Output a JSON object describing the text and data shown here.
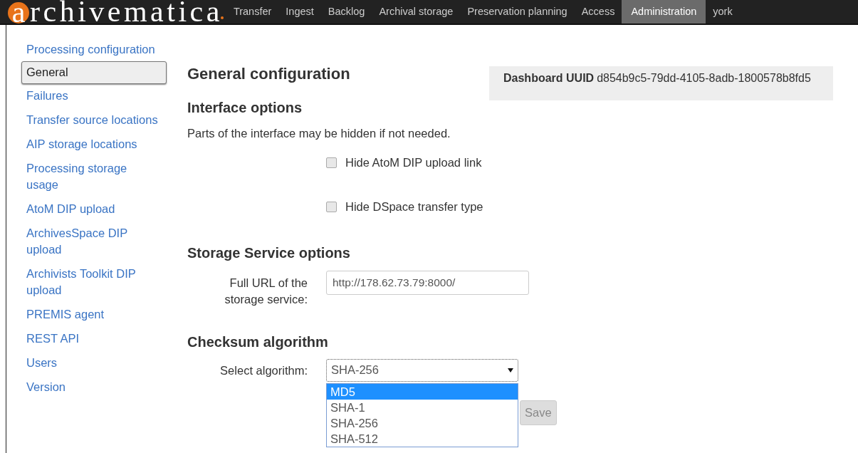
{
  "logo": {
    "mark": "a",
    "text": "rchivematica"
  },
  "nav": [
    {
      "label": "Transfer",
      "selected": false
    },
    {
      "label": "Ingest",
      "selected": false
    },
    {
      "label": "Backlog",
      "selected": false
    },
    {
      "label": "Archival storage",
      "selected": false
    },
    {
      "label": "Preservation planning",
      "selected": false
    },
    {
      "label": "Access",
      "selected": false
    },
    {
      "label": "Administration",
      "selected": true
    },
    {
      "label": "york",
      "selected": false
    }
  ],
  "sidebar": [
    {
      "label": "Processing configuration",
      "selected": false
    },
    {
      "label": "General",
      "selected": true
    },
    {
      "label": "Failures",
      "selected": false
    },
    {
      "label": "Transfer source locations",
      "selected": false
    },
    {
      "label": "AIP storage locations",
      "selected": false
    },
    {
      "label": "Processing storage usage",
      "selected": false
    },
    {
      "label": "AtoM DIP upload",
      "selected": false
    },
    {
      "label": "ArchivesSpace DIP upload",
      "selected": false
    },
    {
      "label": "Archivists Toolkit DIP upload",
      "selected": false
    },
    {
      "label": "PREMIS agent",
      "selected": false
    },
    {
      "label": "REST API",
      "selected": false
    },
    {
      "label": "Users",
      "selected": false
    },
    {
      "label": "Version",
      "selected": false
    }
  ],
  "title": "General configuration",
  "dashboard": {
    "label": "Dashboard UUID",
    "value": "d854b9c5-79dd-4105-8adb-1800578b8fd5"
  },
  "interface": {
    "heading": "Interface options",
    "note": "Parts of the interface may be hidden if not needed.",
    "options": [
      {
        "label": "Hide AtoM DIP upload link",
        "checked": false
      },
      {
        "label": "Hide DSpace transfer type",
        "checked": false
      }
    ]
  },
  "storage": {
    "heading": "Storage Service options",
    "label": "Full URL of the storage service:",
    "value": "http://178.62.73.79:8000/"
  },
  "checksum": {
    "heading": "Checksum algorithm",
    "label": "Select algorithm:",
    "value": "SHA-256",
    "expanded": true,
    "options": [
      {
        "label": "MD5",
        "highlighted": true
      },
      {
        "label": "SHA-1",
        "highlighted": false
      },
      {
        "label": "SHA-256",
        "highlighted": false
      },
      {
        "label": "SHA-512",
        "highlighted": false
      }
    ]
  },
  "save_button": "Save"
}
